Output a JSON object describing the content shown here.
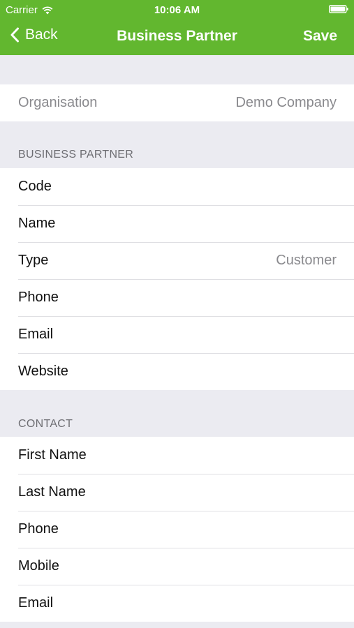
{
  "status_bar": {
    "carrier": "Carrier",
    "time": "10:06 AM"
  },
  "nav": {
    "back_label": "Back",
    "title": "Business Partner",
    "save_label": "Save"
  },
  "organisation": {
    "label": "Organisation",
    "value": "Demo Company"
  },
  "business_partner": {
    "header": "BUSINESS PARTNER",
    "fields": [
      {
        "label": "Code",
        "value": ""
      },
      {
        "label": "Name",
        "value": ""
      },
      {
        "label": "Type",
        "value": "Customer"
      },
      {
        "label": "Phone",
        "value": ""
      },
      {
        "label": "Email",
        "value": ""
      },
      {
        "label": "Website",
        "value": ""
      }
    ]
  },
  "contact": {
    "header": "CONTACT",
    "fields": [
      {
        "label": "First Name",
        "value": ""
      },
      {
        "label": "Last Name",
        "value": ""
      },
      {
        "label": "Phone",
        "value": ""
      },
      {
        "label": "Mobile",
        "value": ""
      },
      {
        "label": "Email",
        "value": ""
      }
    ]
  },
  "colors": {
    "nav_background": "#62b72f",
    "page_background": "#ebebf1",
    "value_text": "#8a8a8e"
  },
  "icons": {
    "signal": "wifi-icon",
    "battery": "battery-icon",
    "back": "chevron-left-icon"
  }
}
